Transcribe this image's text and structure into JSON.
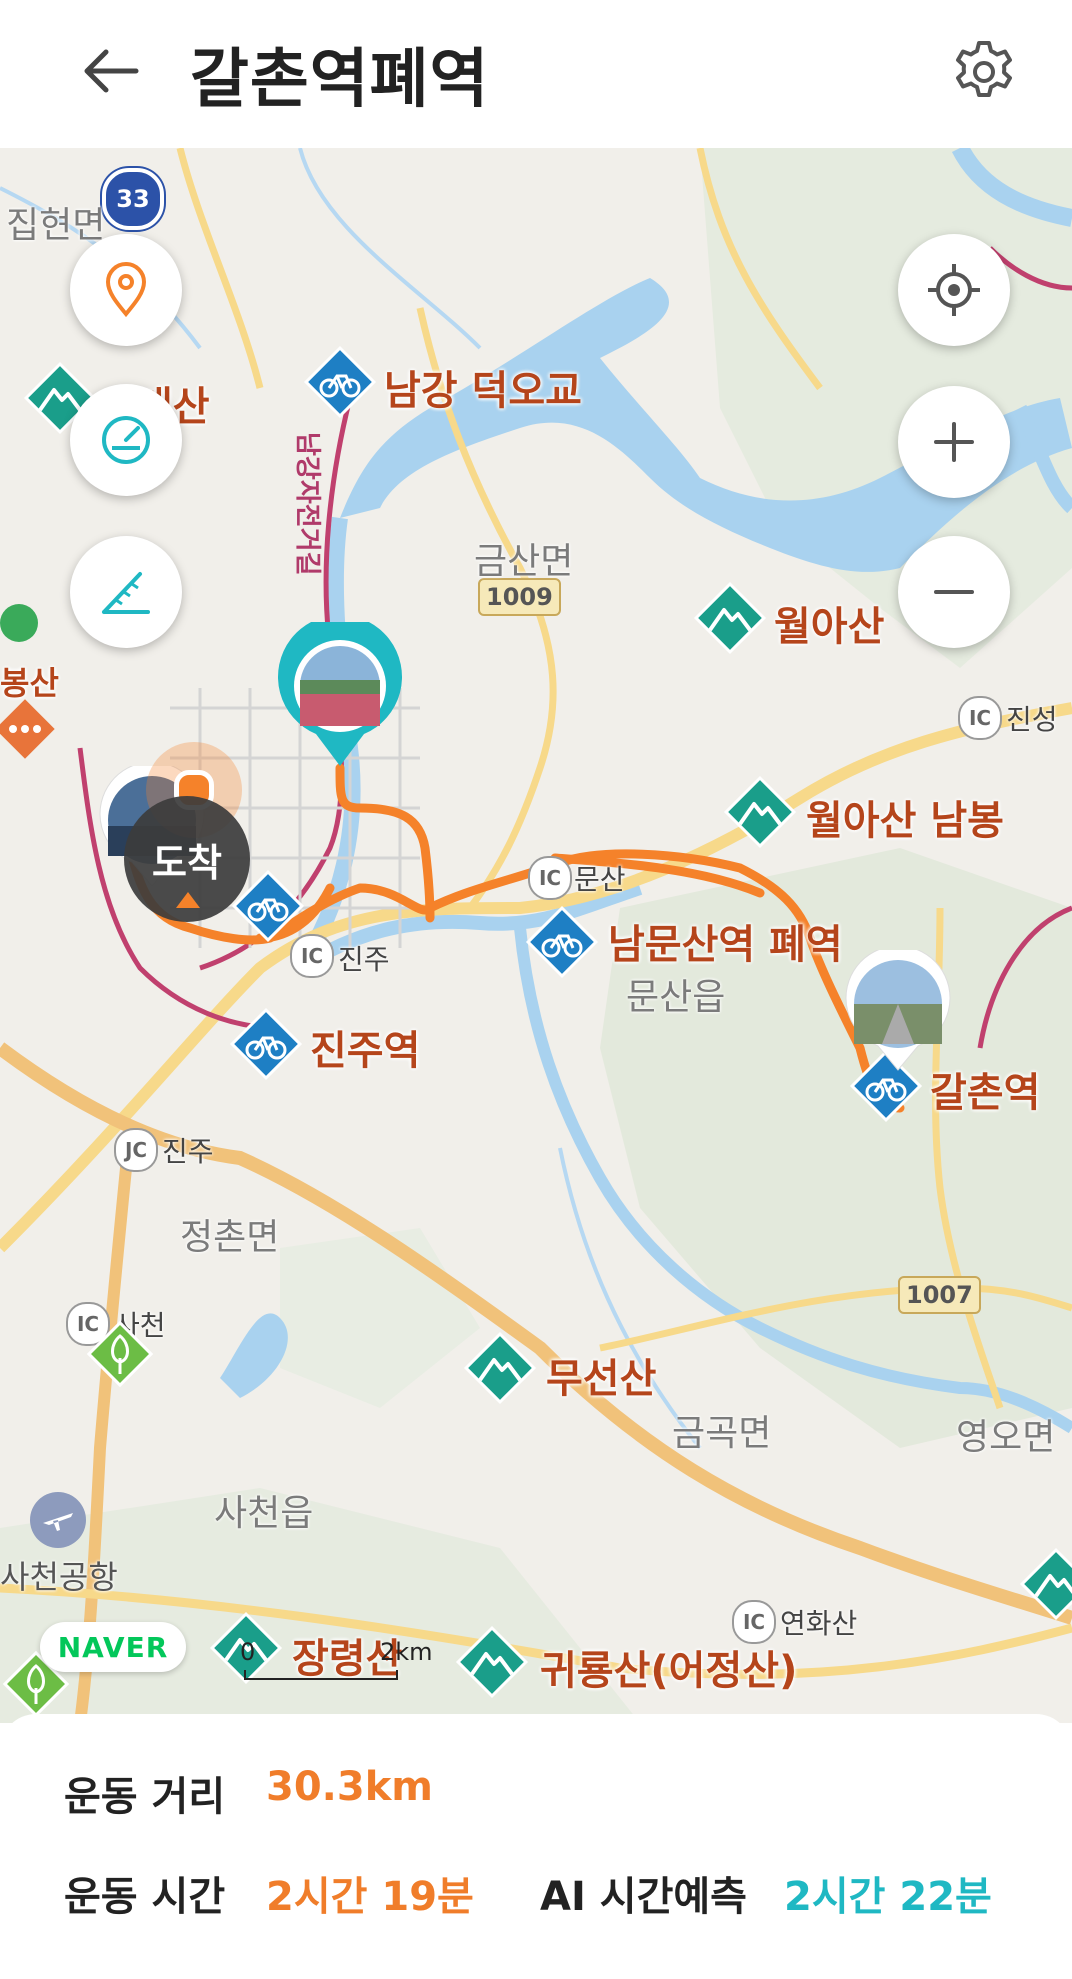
{
  "header": {
    "title": "갈촌역폐역"
  },
  "map": {
    "route_label": "남강자전거길",
    "places": [
      {
        "name": "남강 덕오교"
      },
      {
        "name": "월아산"
      },
      {
        "name": "월아산 남봉"
      },
      {
        "name": "남문산역 폐역"
      },
      {
        "name": "진주역"
      },
      {
        "name": "갈촌역"
      },
      {
        "name": "무선산"
      },
      {
        "name": "장령산"
      },
      {
        "name": "귀룡산(어정산)"
      },
      {
        "name": "대산"
      },
      {
        "name": "봉산"
      }
    ],
    "towns": [
      "집현면",
      "금산면",
      "문산읍",
      "정촌면",
      "금곡면",
      "사천읍",
      "영오면",
      "사천공항"
    ],
    "interchanges": [
      {
        "type": "IC",
        "name": "진성"
      },
      {
        "type": "IC",
        "name": "진주"
      },
      {
        "type": "IC",
        "name": "문산"
      },
      {
        "type": "JC",
        "name": "진주"
      },
      {
        "type": "IC",
        "name": "사천"
      },
      {
        "type": "IC",
        "name": "연화산"
      }
    ],
    "road_numbers": [
      "33",
      "1009",
      "1007"
    ],
    "arrive_label": "도착",
    "naver_logo": "NAVER",
    "scale": {
      "start": "0",
      "end": "2km"
    },
    "route_color": "#f5822a",
    "bike_marker_color": "#1e7fc4",
    "mountain_marker_color": "#1a9e8a"
  },
  "controls": {
    "left": [
      "location-pin-icon",
      "speedometer-icon",
      "ruler-icon"
    ],
    "right": [
      "my-location-icon",
      "zoom-in-icon",
      "zoom-out-icon"
    ]
  },
  "stats": {
    "distance_label": "운동 거리",
    "distance_value": "30.3km",
    "time_label": "운동 시간",
    "time_value": "2시간 19분",
    "ai_label": "AI 시간예측",
    "ai_value": "2시간 22분",
    "accent_orange": "#f07d2a",
    "accent_teal": "#1fb8c3"
  }
}
